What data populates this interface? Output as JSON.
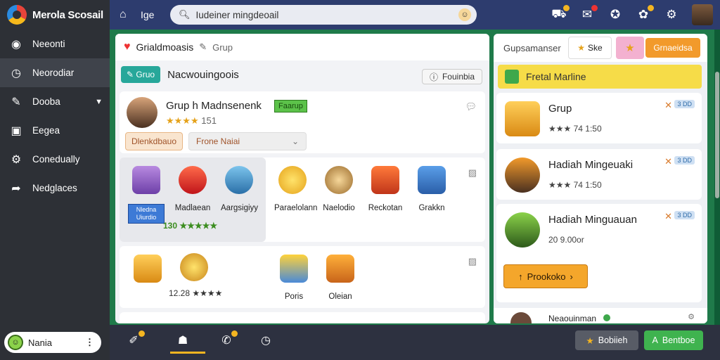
{
  "app": {
    "name": "Merola Scosail"
  },
  "sidebar": {
    "items": [
      {
        "label": "Neeonti",
        "icon": "chrome-icon"
      },
      {
        "label": "Neorodiar",
        "icon": "clock-icon"
      },
      {
        "label": "Dooba",
        "icon": "wrench-icon"
      },
      {
        "label": "Eegea",
        "icon": "window-icon"
      },
      {
        "label": "Conedually",
        "icon": "gear-icon"
      },
      {
        "label": "Nedglaces",
        "icon": "share-icon"
      }
    ],
    "user": {
      "name": "Nania"
    }
  },
  "topbar": {
    "home_label": "Ige",
    "search": {
      "value": "Iudeiner mingdeoail"
    }
  },
  "main": {
    "header": {
      "title": "Grialdmoasis",
      "subtitle": "Grup"
    },
    "subbar": {
      "pill": "Gruo",
      "title": "Nacwouingoois",
      "forum": "Fouinbia"
    },
    "card1": {
      "title": "Grup  h Madnsenenk",
      "tag": "Faarup",
      "stars": "★★★★",
      "rating": "151",
      "button": "Dlenkdbauo",
      "select_value": "Frone Naiai"
    },
    "card2": {
      "label": "Nledna Uiurdio",
      "score": "130 ★★★★★",
      "items": [
        "Madlaean",
        "Aargsigiyy",
        "Paraelolann",
        "Naelodio",
        "Reckotan",
        "Grakkn"
      ]
    },
    "card3": {
      "score": "12.28 ★★★★",
      "items": [
        "Poris",
        "Oleian"
      ]
    }
  },
  "right": {
    "tabs": {
      "tab1": "Gupsamanser",
      "tab2": "Ske",
      "button": "Grnaeidsa"
    },
    "header": "Fretal Marline",
    "items": [
      {
        "title": "Grup",
        "meta": "★★★ 74 1:50",
        "tag": "3 DD"
      },
      {
        "title": "Hadiah Mingeuaki",
        "meta": "★★★ 74 1:50",
        "tag": "3 DD"
      },
      {
        "title": "Hadiah Minguauan",
        "meta": "20  9.00or",
        "tag": "3 DD"
      }
    ],
    "proceed": "Prookoko",
    "footer_name": "Neaouinman"
  },
  "bottombar": {
    "btn1": "Bobiieh",
    "btn2": "Bentboe"
  },
  "colors": {
    "sidebar": "#2d3036",
    "topbar": "#2d3c6e",
    "accent_orange": "#f29a2b",
    "accent_green": "#3fb34f",
    "header_yellow": "#f6dc48"
  }
}
